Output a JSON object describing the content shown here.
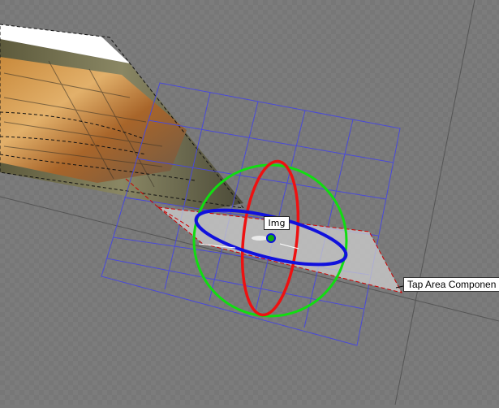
{
  "scene": {
    "background_color": "#7a7a7a",
    "grid_line_color": "#868686",
    "image_element_label": "Img",
    "component_label": "Tap Area Componen"
  },
  "gizmo": {
    "x_axis_color": "#ee1111",
    "y_axis_color": "#11dd11",
    "z_axis_color": "#1111dd",
    "center_icon": "pivot-dot-icon"
  },
  "rect_transform": {
    "grid_color": "#4a4ad8",
    "outline_color": "#cc0000"
  }
}
